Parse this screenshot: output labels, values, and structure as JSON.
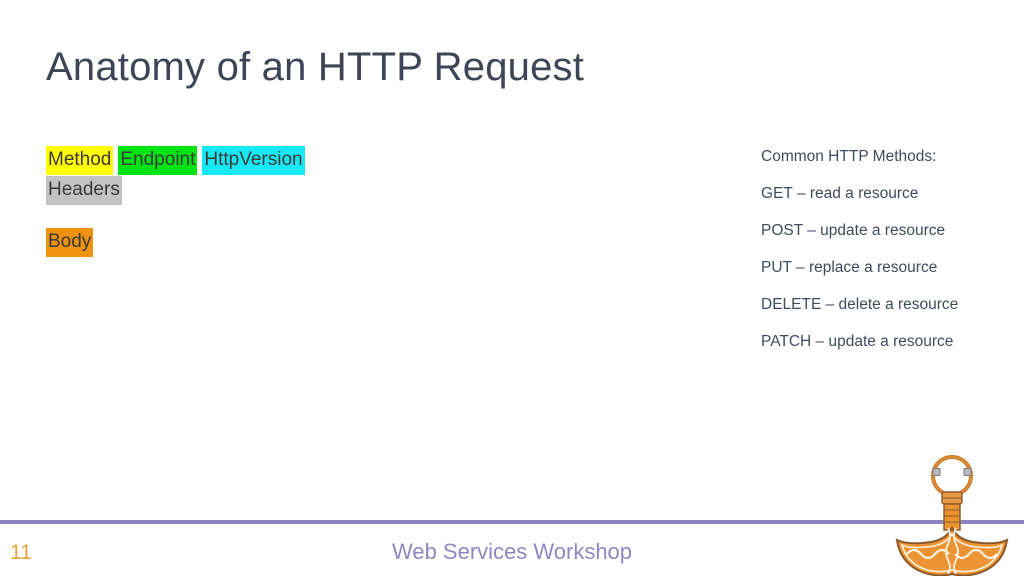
{
  "slide": {
    "title": "Anatomy of an HTTP Request",
    "background_color": "#ffffff",
    "title_color": "#3f4456"
  },
  "request_anatomy": {
    "lines": [
      {
        "tokens": [
          {
            "text": "Method",
            "highlight_color": "#ffff00",
            "name": "method"
          },
          {
            "text": "Endpoint",
            "highlight_color": "#00e512",
            "name": "endpoint"
          },
          {
            "text": "HttpVersion",
            "highlight_color": "#16e9f5",
            "name": "http-version"
          }
        ]
      },
      {
        "tokens": [
          {
            "text": "Headers",
            "highlight_color": "#c3c3c3",
            "name": "headers"
          }
        ]
      },
      {
        "tokens": [
          {
            "text": "Body",
            "highlight_color": "#ef930f",
            "name": "body"
          }
        ]
      }
    ],
    "method_label": "Method",
    "endpoint_label": "Endpoint",
    "http_version_label": "HttpVersion",
    "headers_label": "Headers",
    "body_label": "Body"
  },
  "methods_panel": {
    "heading": "Common HTTP Methods:",
    "items": [
      {
        "text": "GET – read a resource",
        "verb": "GET",
        "description": "read a resource"
      },
      {
        "text": "POST – update a resource",
        "verb": "POST",
        "description": "update a resource"
      },
      {
        "text": "PUT – replace a resource",
        "verb": "PUT",
        "description": "replace a resource"
      },
      {
        "text": "DELETE – delete a resource",
        "verb": "DELETE",
        "description": "delete a resource"
      },
      {
        "text": "PATCH – update a resource",
        "verb": "PATCH",
        "description": "update a resource"
      }
    ],
    "text_color": "#414a5c"
  },
  "footer": {
    "page_number": "11",
    "page_number_color": "#e5a33c",
    "title": "Web Services Workshop",
    "title_color": "#8e88c2",
    "rule_color": "#8a83bd"
  },
  "logo": {
    "name": "mjolnir-hammer-logo",
    "color": "#e08a33",
    "outline_color": "#8a5a2b"
  }
}
